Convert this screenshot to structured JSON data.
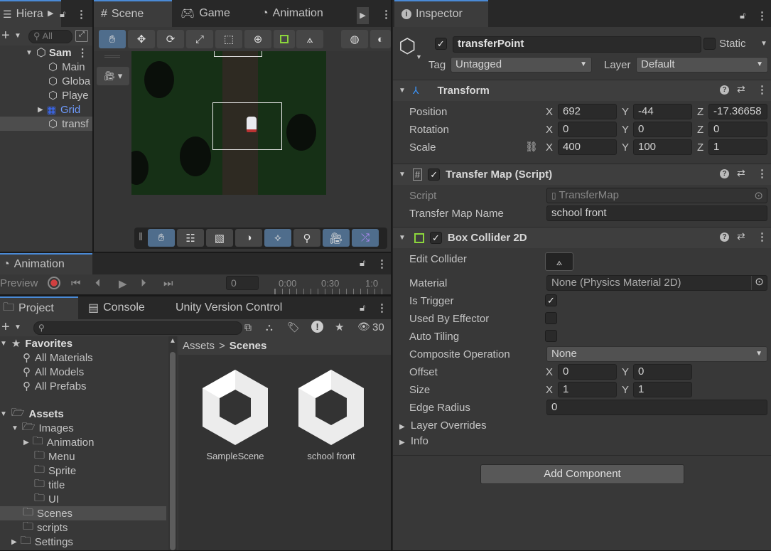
{
  "hierarchy": {
    "tab": "Hiera",
    "search_placeholder": "All",
    "scene_name": "Sam",
    "items": [
      "Main",
      "Globa",
      "Playe",
      "Grid",
      "transf"
    ]
  },
  "scene_tabs": {
    "scene": "Scene",
    "game": "Game",
    "animation": "Animation"
  },
  "animation_panel": {
    "tab": "Animation",
    "preview": "Preview",
    "frame": "0",
    "ticks": [
      "0:00",
      "0:30",
      "1:0"
    ]
  },
  "project": {
    "tabs": {
      "project": "Project",
      "console": "Console",
      "uvc": "Unity Version Control"
    },
    "count": "30",
    "favorites": {
      "title": "Favorites",
      "items": [
        "All Materials",
        "All Models",
        "All Prefabs"
      ]
    },
    "assets": {
      "title": "Assets",
      "images": "Images",
      "image_children": [
        "Animation",
        "Menu",
        "Sprite",
        "title",
        "UI"
      ],
      "scenes": "Scenes",
      "scripts": "scripts",
      "settings": "Settings"
    },
    "breadcrumb": {
      "root": "Assets",
      "sep": ">",
      "current": "Scenes"
    },
    "files": [
      "SampleScene",
      "school front"
    ]
  },
  "inspector": {
    "tab": "Inspector",
    "object_name": "transferPoint",
    "static_label": "Static",
    "tag_label": "Tag",
    "tag_value": "Untagged",
    "layer_label": "Layer",
    "layer_value": "Default",
    "transform": {
      "title": "Transform",
      "position_label": "Position",
      "rotation_label": "Rotation",
      "scale_label": "Scale",
      "axis": {
        "x": "X",
        "y": "Y",
        "z": "Z"
      },
      "position": {
        "x": "692",
        "y": "-44",
        "z": "-17.36658"
      },
      "rotation": {
        "x": "0",
        "y": "0",
        "z": "0"
      },
      "scale": {
        "x": "400",
        "y": "100",
        "z": "1"
      }
    },
    "transfer_map": {
      "title": "Transfer Map (Script)",
      "script_label": "Script",
      "script_value": "TransferMap",
      "name_label": "Transfer Map Name",
      "name_value": "school front"
    },
    "box_collider": {
      "title": "Box Collider 2D",
      "edit_collider": "Edit Collider",
      "material_label": "Material",
      "material_value": "None (Physics Material 2D)",
      "is_trigger": "Is Trigger",
      "used_by_effector": "Used By Effector",
      "auto_tiling": "Auto Tiling",
      "composite_label": "Composite Operation",
      "composite_value": "None",
      "offset_label": "Offset",
      "offset": {
        "x": "0",
        "y": "0"
      },
      "size_label": "Size",
      "size": {
        "x": "1",
        "y": "1"
      },
      "edge_radius_label": "Edge Radius",
      "edge_radius": "0",
      "layer_overrides": "Layer Overrides",
      "info": "Info",
      "is_trigger_checked": true,
      "used_by_effector_checked": false,
      "auto_tiling_checked": false
    },
    "add_component": "Add Component"
  },
  "colors": {
    "accent": "#4a8ad6",
    "selected_row": "#4d4d4d",
    "green_icon": "#8cd63c",
    "scene_bg": "#163016"
  }
}
